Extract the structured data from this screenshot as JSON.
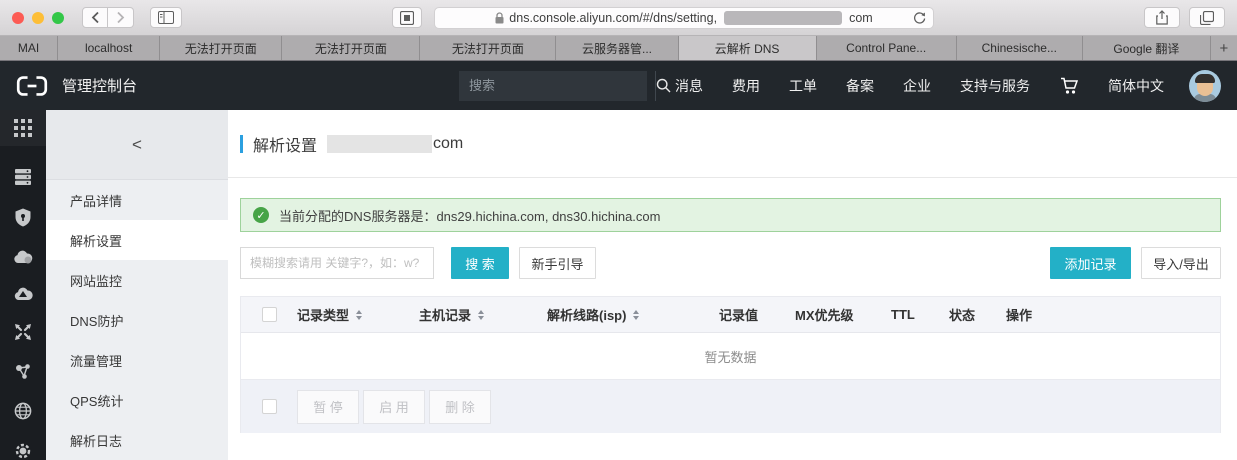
{
  "browser": {
    "url_prefix": "dns.console.aliyun.com/#/dns/setting,",
    "url_suffix": "com",
    "tabs": [
      {
        "label": "MAI"
      },
      {
        "label": "localhost"
      },
      {
        "label": "无法打开页面"
      },
      {
        "label": "无法打开页面"
      },
      {
        "label": "无法打开页面"
      },
      {
        "label": "云服务器管..."
      },
      {
        "label": "云解析 DNS",
        "active": true
      },
      {
        "label": "Control Pane..."
      },
      {
        "label": "Chinesische..."
      },
      {
        "label": "Google 翻译"
      }
    ],
    "new_tab_label": "+",
    "traffic_colors": [
      "#fc5b54",
      "#fdbe37",
      "#33c748"
    ]
  },
  "topnav": {
    "console_title": "管理控制台",
    "search_placeholder": "搜索",
    "items": [
      "消息",
      "费用",
      "工单",
      "备案",
      "企业",
      "支持与服务"
    ],
    "language": "简体中文"
  },
  "icon_rail": [
    "apps-grid",
    "server",
    "security-shield",
    "cloud",
    "cloud-storage",
    "scale-arrows",
    "network-nodes",
    "globe",
    "gear"
  ],
  "sidebar": {
    "collapse_label": "<",
    "items": [
      {
        "label": "产品详情"
      },
      {
        "label": "解析设置",
        "active": true
      },
      {
        "label": "网站监控"
      },
      {
        "label": "DNS防护"
      },
      {
        "label": "流量管理"
      },
      {
        "label": "QPS统计"
      },
      {
        "label": "解析日志"
      }
    ]
  },
  "page": {
    "title": "解析设置",
    "title_suffix": "com",
    "alert_text": "当前分配的DNS服务器是：dns29.hichina.com, dns30.hichina.com",
    "toolbar": {
      "search_placeholder": "模糊搜索请用 关键字?，如：w?",
      "search_button": "搜 索",
      "guide_button": "新手引导",
      "add_button": "添加记录",
      "import_export_button": "导入/导出"
    },
    "table": {
      "headers": [
        "记录类型",
        "主机记录",
        "解析线路(isp)",
        "记录值",
        "MX优先级",
        "TTL",
        "状态",
        "操作"
      ],
      "empty_text": "暂无数据",
      "footer_buttons": [
        "暂 停",
        "启 用",
        "删 除"
      ]
    },
    "colors": {
      "primary": "#23b0c7",
      "title_accent": "#2ba0e0",
      "success": "#47a447"
    }
  }
}
